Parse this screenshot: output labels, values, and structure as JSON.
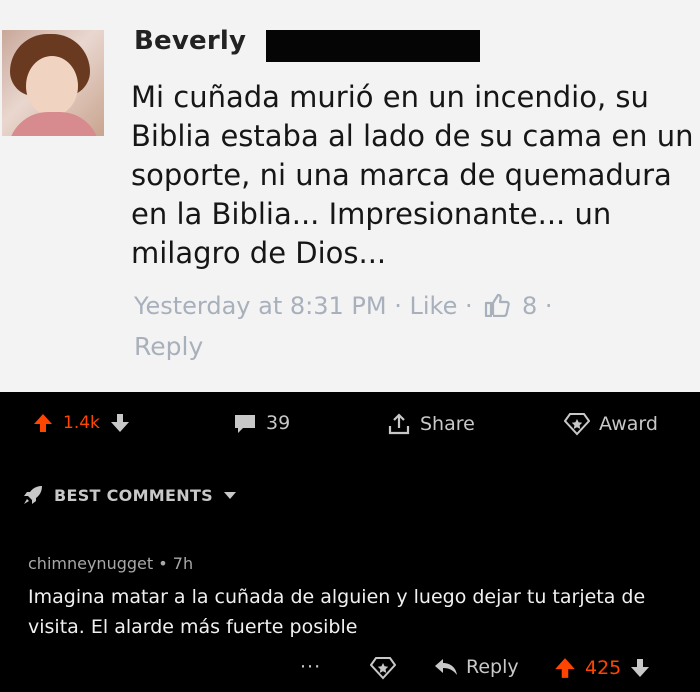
{
  "facebook": {
    "commenter_name": "Beverly",
    "comment_text": "Mi cuñada murió en un incendio, su Biblia estaba al lado de su cama en un soporte, ni una marca de quemadura en la Biblia... Impresionante... un milagro de Dios...",
    "timestamp": "Yesterday at 8:31 PM",
    "like_label": "Like",
    "like_count": "8",
    "reply_label": "Reply",
    "separator": "·"
  },
  "post_actions": {
    "upvotes": "1.4k",
    "comment_count": "39",
    "share_label": "Share",
    "award_label": "Award"
  },
  "sort": {
    "label": "BEST COMMENTS"
  },
  "top_comment": {
    "username": "chimneynugget",
    "age": "7h",
    "body": "Imagina matar a la cuñada de alguien y luego dejar tu tarjeta de visita. El alarde más fuerte posible",
    "more_label": "···",
    "reply_label": "Reply",
    "score": "425"
  },
  "colors": {
    "upvote": "#ff4500",
    "fb_meta": "#a8b0bc",
    "dark_bg": "#000000"
  }
}
